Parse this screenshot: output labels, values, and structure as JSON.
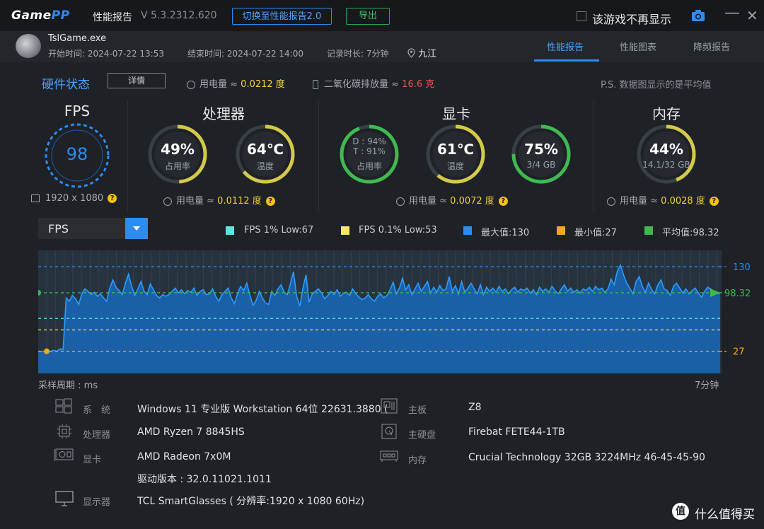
{
  "titlebar": {
    "logo_main": "Game",
    "logo_accent": "PP",
    "title": "性能报告",
    "version": "V 5.3.2312.620",
    "switch_btn": "切换至性能报告2.0",
    "export_btn": "导出",
    "hide_label": "该游戏不再显示",
    "minimize": "—",
    "close": "✕"
  },
  "header": {
    "exe": "TslGame.exe",
    "start": "开始时间: 2024-07-22 13:53",
    "end": "结束时间: 2024-07-22 14:00",
    "duration": "记录时长: 7分钟",
    "location": "九江",
    "tabs": [
      {
        "label": "性能报告",
        "active": true
      },
      {
        "label": "性能图表",
        "active": false
      },
      {
        "label": "降频报告",
        "active": false
      }
    ]
  },
  "status": {
    "title": "硬件状态",
    "details_btn": "详情",
    "power_label": "用电量 ≈ ",
    "power_value": "0.0212 度",
    "co2_label": "二氧化碳排放量 ≈ ",
    "co2_value": "16.6 克",
    "ps_note": "P.S. 数据图显示的是平均值"
  },
  "fps": {
    "title": "FPS",
    "value": "98",
    "resolution": "1920 x 1080"
  },
  "cpu": {
    "title": "处理器",
    "usage": {
      "value": "49%",
      "label": "占用率",
      "fraction": 0.49
    },
    "temp": {
      "value": "64℃",
      "label": "温度",
      "fraction": 0.64
    },
    "power_label": "用电量 ≈ ",
    "power_value": "0.0112 度"
  },
  "gpu": {
    "title": "显卡",
    "usage": {
      "line1": "D : 94%",
      "line2": "T : 91%",
      "label": "占用率",
      "fraction": 0.94
    },
    "temp": {
      "value": "61℃",
      "label": "温度",
      "fraction": 0.61
    },
    "vram": {
      "value": "75%",
      "label": "3/4 GB",
      "fraction": 0.75
    },
    "power_label": "用电量 ≈ ",
    "power_value": "0.0072 度"
  },
  "mem": {
    "title": "内存",
    "usage": {
      "value": "44%",
      "label": "14.1/32 GB",
      "fraction": 0.44
    },
    "power_label": "用电量 ≈ ",
    "power_value": "0.0028 度"
  },
  "chart_controls": {
    "metric": "FPS",
    "legend": [
      {
        "label": "FPS 1% Low:67",
        "color": "#5ee7df"
      },
      {
        "label": "FPS 0.1% Low:53",
        "color": "#f7e967"
      },
      {
        "label": "最大值:130",
        "color": "#2c8cf0"
      },
      {
        "label": "最小值:27",
        "color": "#f5a623"
      },
      {
        "label": "平均值:98.32",
        "color": "#3fb950"
      }
    ]
  },
  "chart_data": {
    "type": "area",
    "ylim": [
      0,
      150
    ],
    "x_start_label": "采样周期 : ms",
    "x_end_label": "7分钟",
    "references": [
      {
        "name": "最大值",
        "value": 130,
        "label": "130",
        "color": "#2c8cf0"
      },
      {
        "name": "平均值",
        "value": 98.32,
        "label": "98.32",
        "color": "#3fb950"
      },
      {
        "name": "FPS 1% Low",
        "value": 67,
        "color": "#5ee7df"
      },
      {
        "name": "FPS 0.1% Low",
        "value": 53,
        "color": "#f7e967"
      },
      {
        "name": "最小值",
        "value": 27,
        "label": "27",
        "color": "#f5a623"
      }
    ],
    "series": [
      {
        "values": [
          27,
          27,
          27,
          27,
          27,
          28,
          27,
          30,
          29,
          92,
          88,
          95,
          91,
          84,
          97,
          103,
          100,
          96,
          99,
          94,
          97,
          92,
          88,
          104,
          114,
          105,
          101,
          96,
          110,
          121,
          106,
          95,
          103,
          112,
          100,
          96,
          109,
          102,
          95,
          92,
          96,
          94,
          96,
          100,
          104,
          98,
          102,
          97,
          101,
          99,
          104,
          95,
          100,
          102,
          96,
          97,
          103,
          94,
          88,
          96,
          100,
          104,
          92,
          85,
          97,
          106,
          101,
          110,
          95,
          83,
          89,
          100,
          92,
          86,
          84,
          100,
          95,
          103,
          108,
          99,
          96,
          109,
          124,
          94,
          82,
          104,
          120,
          87,
          97,
          100,
          103,
          98,
          91,
          95,
          100,
          96,
          102,
          94,
          98,
          99,
          95,
          103,
          97,
          93,
          90,
          92,
          96,
          91,
          88,
          94,
          97,
          92,
          95,
          102,
          111,
          97,
          104,
          116,
          102,
          108,
          96,
          103,
          110,
          100,
          106,
          112,
          98,
          105,
          99,
          107,
          101,
          103,
          118,
          100,
          107,
          97,
          112,
          99,
          104,
          110,
          103,
          97,
          108,
          96,
          105,
          100,
          104,
          99,
          106,
          100,
          103,
          97,
          102,
          105,
          99,
          103,
          101,
          104,
          98,
          102,
          96,
          105,
          100,
          103,
          99,
          106,
          101,
          97,
          103,
          108,
          100,
          104,
          99,
          102,
          98,
          103,
          101,
          105,
          100,
          106,
          102,
          104,
          99,
          103,
          115,
          108,
          125,
          132,
          120,
          110,
          104,
          97,
          112,
          118,
          106,
          99,
          110,
          102,
          97,
          108,
          114,
          103,
          101,
          95,
          106,
          110,
          104,
          98,
          103,
          97,
          101,
          104,
          98,
          93,
          100,
          105,
          103,
          99,
          97,
          98
        ]
      }
    ]
  },
  "specs": {
    "os": {
      "label": "系　统",
      "value": "Windows 11 专业版 Workstation 64位 22631.3880 ("
    },
    "cpu": {
      "label": "处理器",
      "value": "AMD Ryzen 7 8845HS"
    },
    "gpu": {
      "label": "显卡",
      "value": "AMD Radeon 7x0M",
      "driver": "驱动版本 : 32.0.11021.1011"
    },
    "monitor": {
      "label": "显示器",
      "value": "TCL SmartGlasses ( 分辨率:1920 x 1080 60Hz)"
    },
    "board": {
      "label": "主板",
      "value": "Z8"
    },
    "disk": {
      "label": "主硬盘",
      "value": "Firebat FETE44-1TB"
    },
    "mem": {
      "label": "内存",
      "value": "Crucial Technology 32GB 3224MHz 46-45-45-90"
    }
  },
  "watermark": {
    "icon": "值",
    "text": "什么值得买"
  }
}
